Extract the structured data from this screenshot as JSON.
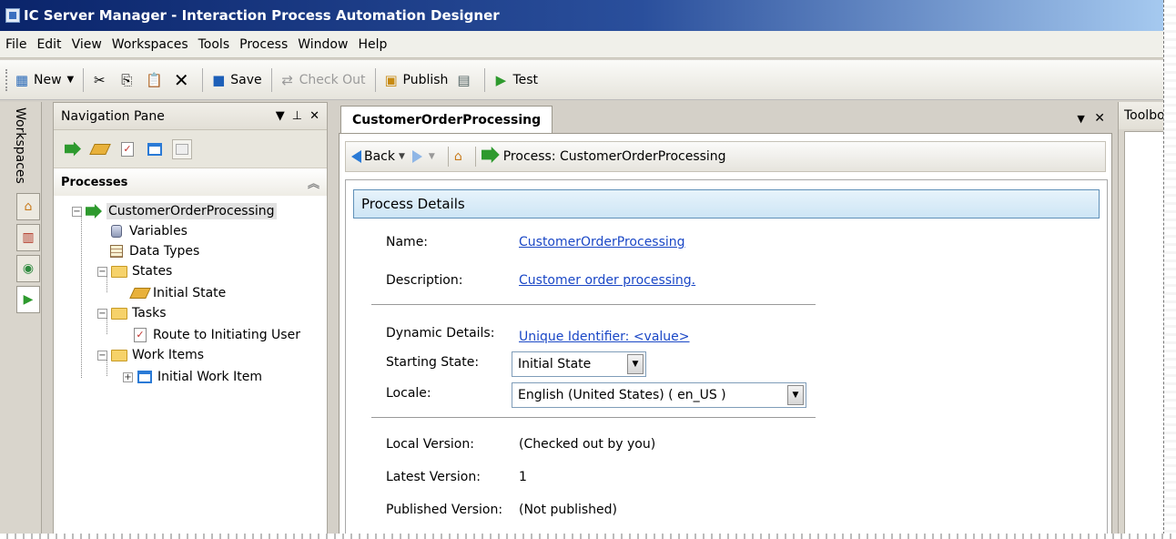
{
  "window": {
    "title": "IC Server Manager - Interaction Process Automation Designer"
  },
  "menu": [
    "File",
    "Edit",
    "View",
    "Workspaces",
    "Tools",
    "Process",
    "Window",
    "Help"
  ],
  "toolbar": {
    "new_label": "New",
    "save_label": "Save",
    "checkout_label": "Check Out",
    "publish_label": "Publish",
    "test_label": "Test"
  },
  "workspaces": {
    "label": "Workspaces"
  },
  "nav": {
    "title": "Navigation Pane",
    "section": "Processes",
    "tree": {
      "root": "CustomerOrderProcessing",
      "variables": "Variables",
      "data_types": "Data Types",
      "states": "States",
      "initial_state": "Initial State",
      "tasks": "Tasks",
      "route_task": "Route to Initiating User",
      "work_items": "Work Items",
      "initial_work_item": "Initial Work Item"
    }
  },
  "doc": {
    "tab_label": "CustomerOrderProcessing",
    "back_label": "Back",
    "breadcrumb": "Process: CustomerOrderProcessing",
    "section_title": "Process Details",
    "fields": {
      "name_label": "Name:",
      "name_value": "CustomerOrderProcessing",
      "desc_label": "Description:",
      "desc_value": "Customer order processing.",
      "dyn_label": "Dynamic Details:",
      "dyn_value": "Unique Identifier: <value>",
      "start_label": "Starting State:",
      "start_value": "Initial State",
      "locale_label": "Locale:",
      "locale_value": "English (United States) ( en_US )",
      "localver_label": "Local Version:",
      "localver_value": "(Checked out by you)",
      "latest_label": "Latest Version:",
      "latest_value": "1",
      "pub_label": "Published Version:",
      "pub_value": "(Not published)"
    }
  },
  "toolbox": {
    "title": "Toolbox"
  },
  "colors": {
    "link": "#1a47c6",
    "title_start": "#0a246a",
    "title_end": "#a6caf0"
  }
}
